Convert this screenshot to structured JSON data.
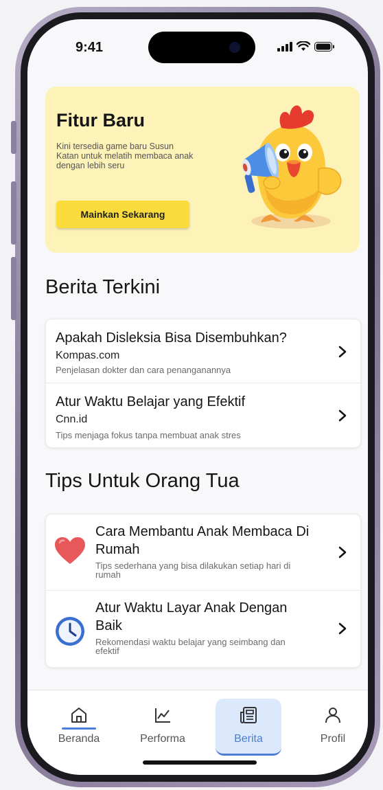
{
  "status": {
    "time": "9:41"
  },
  "banner": {
    "title": "Fitur Baru",
    "description": "Kini tersedia game baru Susun Katan untuk melatih membaca anak dengan lebih seru",
    "button_label": "Mainkan Sekarang"
  },
  "news": {
    "section_title": "Berita Terkini",
    "items": [
      {
        "title": "Apakah Disleksia Bisa Disembuhkan?",
        "source": "Kompas.com",
        "desc": "Penjelasan dokter dan cara penanganannya"
      },
      {
        "title": "Atur Waktu Belajar yang Efektif",
        "source": "Cnn.id",
        "desc": "Tips menjaga fokus tanpa membuat anak stres"
      }
    ]
  },
  "tips": {
    "section_title": "Tips Untuk Orang Tua",
    "items": [
      {
        "title": "Cara Membantu Anak Membaca Di Rumah",
        "desc": "Tips sederhana yang bisa dilakukan setiap hari di rumah",
        "icon": "heart-icon"
      },
      {
        "title": "Atur Waktu Layar Anak Dengan Baik",
        "desc": "Rekomendasi waktu belajar yang seimbang dan efektif",
        "icon": "clock-icon"
      }
    ]
  },
  "nav": {
    "items": [
      {
        "label": "Beranda",
        "icon": "home-icon"
      },
      {
        "label": "Performa",
        "icon": "chart-icon"
      },
      {
        "label": "Berita",
        "icon": "newspaper-icon",
        "active": true
      },
      {
        "label": "Profil",
        "icon": "user-icon"
      }
    ]
  },
  "colors": {
    "accent": "#4a7ed6",
    "banner_bg": "#fdf2b7",
    "button": "#fbdc3c"
  }
}
